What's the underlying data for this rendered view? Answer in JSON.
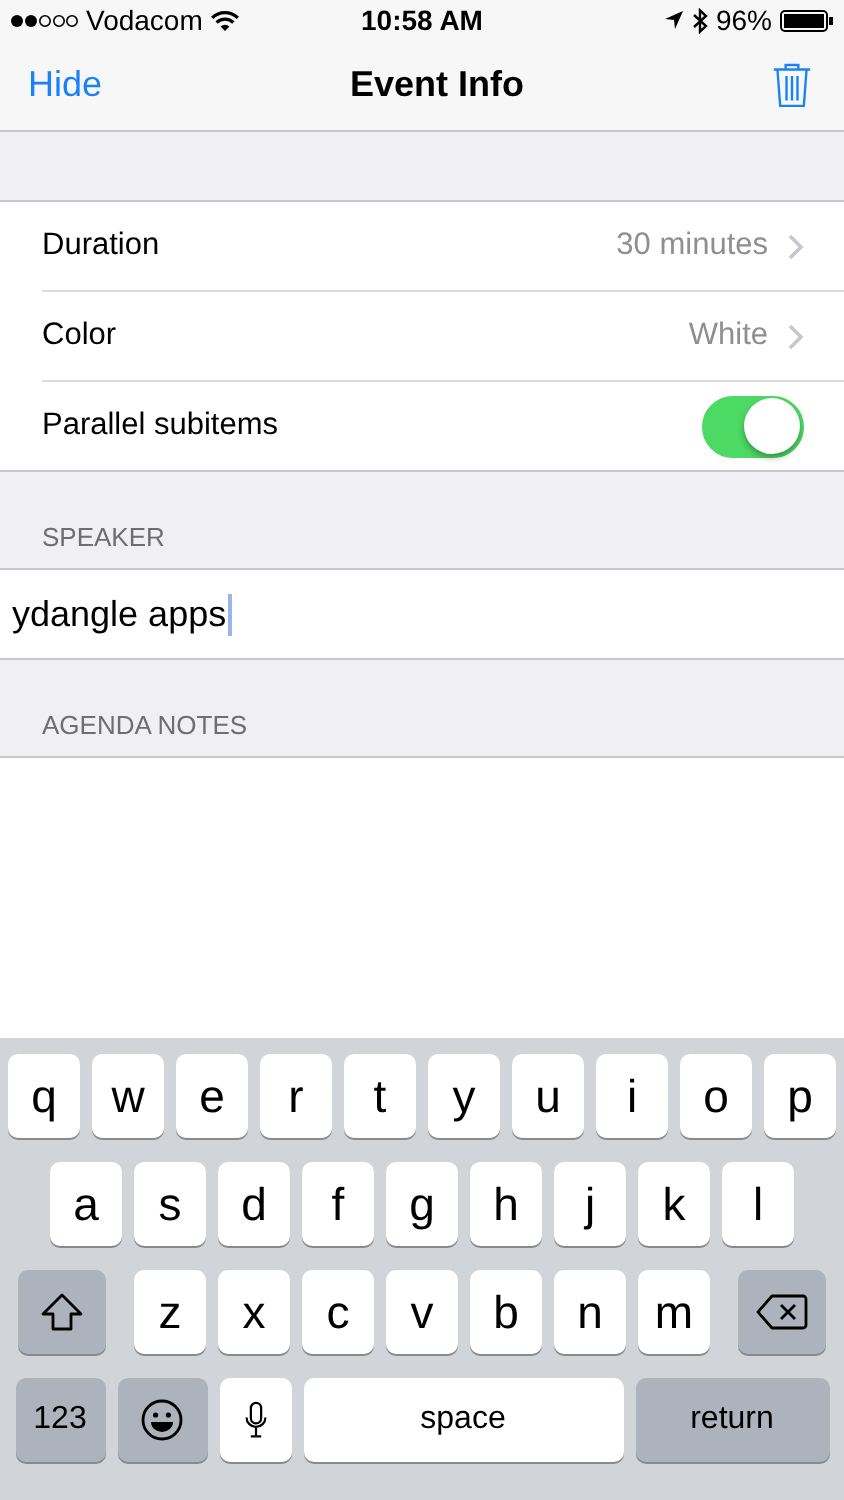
{
  "status_bar": {
    "carrier": "Vodacom",
    "time": "10:58 AM",
    "battery": "96%"
  },
  "nav": {
    "left": "Hide",
    "title": "Event Info"
  },
  "settings": [
    {
      "kind": "value",
      "label": "Duration",
      "value": "30 minutes"
    },
    {
      "kind": "value",
      "label": "Color",
      "value": "White"
    },
    {
      "kind": "toggle",
      "label": "Parallel subitems",
      "on": true
    }
  ],
  "speaker": {
    "header": "SPEAKER",
    "value": "ydangle apps"
  },
  "notes": {
    "header": "AGENDA NOTES"
  },
  "keyboard": {
    "rows": [
      [
        {
          "kind": "letter",
          "label": "q"
        },
        {
          "kind": "letter",
          "label": "w"
        },
        {
          "kind": "letter",
          "label": "e"
        },
        {
          "kind": "letter",
          "label": "r"
        },
        {
          "kind": "letter",
          "label": "t"
        },
        {
          "kind": "letter",
          "label": "y"
        },
        {
          "kind": "letter",
          "label": "u"
        },
        {
          "kind": "letter",
          "label": "i"
        },
        {
          "kind": "letter",
          "label": "o"
        },
        {
          "kind": "letter",
          "label": "p"
        }
      ],
      [
        {
          "kind": "letter",
          "label": "a"
        },
        {
          "kind": "letter",
          "label": "s"
        },
        {
          "kind": "letter",
          "label": "d"
        },
        {
          "kind": "letter",
          "label": "f"
        },
        {
          "kind": "letter",
          "label": "g"
        },
        {
          "kind": "letter",
          "label": "h"
        },
        {
          "kind": "letter",
          "label": "j"
        },
        {
          "kind": "letter",
          "label": "k"
        },
        {
          "kind": "letter",
          "label": "l"
        }
      ],
      [
        {
          "kind": "shift"
        },
        {
          "kind": "letter",
          "label": "z"
        },
        {
          "kind": "letter",
          "label": "x"
        },
        {
          "kind": "letter",
          "label": "c"
        },
        {
          "kind": "letter",
          "label": "v"
        },
        {
          "kind": "letter",
          "label": "b"
        },
        {
          "kind": "letter",
          "label": "n"
        },
        {
          "kind": "letter",
          "label": "m"
        },
        {
          "kind": "delete"
        }
      ]
    ],
    "bottom_row": [
      {
        "kind": "mode",
        "label": "123"
      },
      {
        "kind": "emoji"
      },
      {
        "kind": "mic"
      },
      {
        "kind": "space",
        "label": "space"
      },
      {
        "kind": "return",
        "label": "return"
      }
    ]
  }
}
